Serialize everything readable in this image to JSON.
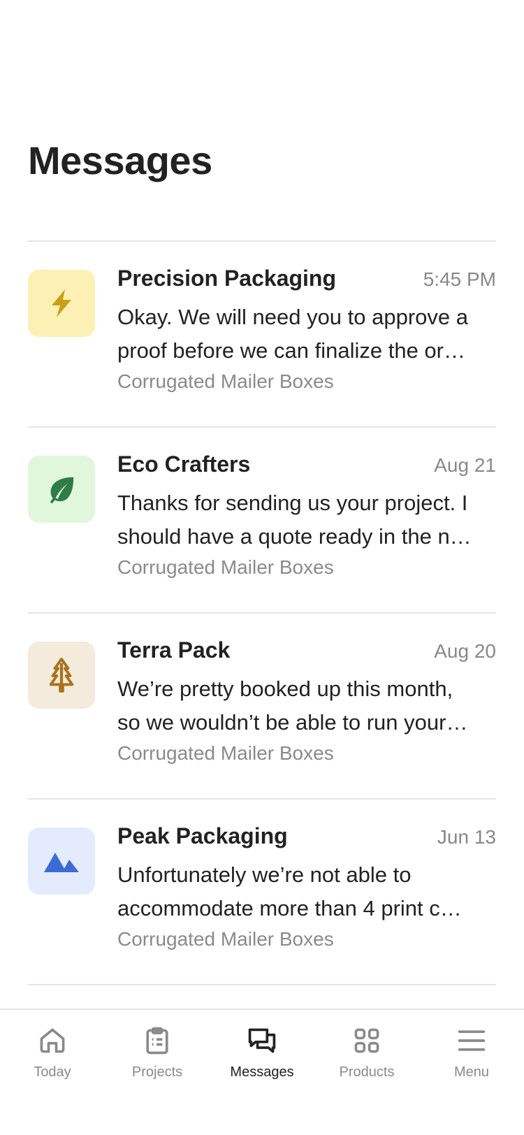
{
  "page": {
    "title": "Messages"
  },
  "conversations": [
    {
      "vendor": "Precision Packaging",
      "time": "5:45 PM",
      "preview_line1": "Okay. We will need you to approve a",
      "preview_line2": "proof before we can finalize the or…",
      "project": "Corrugated Mailer Boxes",
      "icon": "lightning-icon",
      "avatar_bg": "#FDF0B4",
      "icon_color": "#C9A01A"
    },
    {
      "vendor": "Eco Crafters",
      "time": "Aug 21",
      "preview_line1": "Thanks for sending us your project. I",
      "preview_line2": "should have a quote ready in the n…",
      "project": "Corrugated Mailer Boxes",
      "icon": "leaf-icon",
      "avatar_bg": "#E1F7DC",
      "icon_color": "#2E7D46"
    },
    {
      "vendor": "Terra Pack",
      "time": "Aug 20",
      "preview_line1": "We’re pretty booked up this month,",
      "preview_line2": "so we wouldn’t be able to run your…",
      "project": "Corrugated Mailer Boxes",
      "icon": "tree-icon",
      "avatar_bg": "#F4EBDD",
      "icon_color": "#A8731C"
    },
    {
      "vendor": "Peak Packaging",
      "time": "Jun 13",
      "preview_line1": "Unfortunately we’re not able to",
      "preview_line2": "accommodate more than 4 print c…",
      "project": "Corrugated Mailer Boxes",
      "icon": "mountain-icon",
      "avatar_bg": "#E4EBFC",
      "icon_color": "#3B6BD6"
    }
  ],
  "tabbar": {
    "items": [
      {
        "label": "Today",
        "icon": "home-icon",
        "active": false
      },
      {
        "label": "Projects",
        "icon": "clipboard-icon",
        "active": false
      },
      {
        "label": "Messages",
        "icon": "chat-bubbles-icon",
        "active": true
      },
      {
        "label": "Products",
        "icon": "grid-icon",
        "active": false
      },
      {
        "label": "Menu",
        "icon": "hamburger-menu-icon",
        "active": false
      }
    ]
  },
  "colors": {
    "divider": "#E5E5E5",
    "text_primary": "#222222",
    "text_secondary": "#8A8A8A"
  }
}
